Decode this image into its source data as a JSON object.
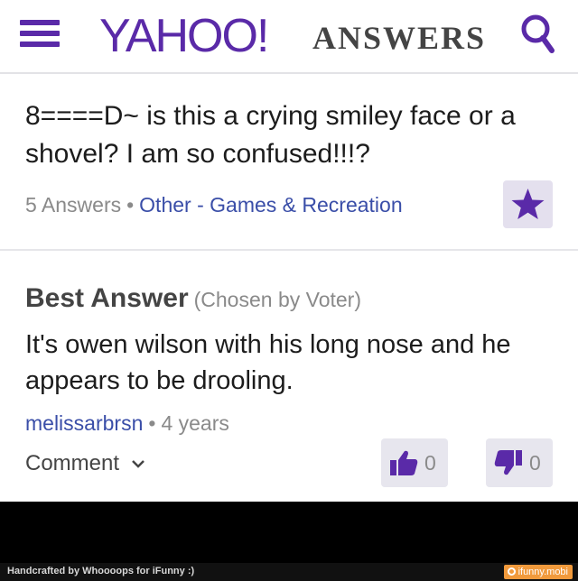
{
  "header": {
    "brand_main": "YAHOO!",
    "brand_sub": "ANSWERS",
    "brand_color": "#5a2aa8"
  },
  "question": {
    "title": "8====D~ is this a crying smiley face or a shovel? I am so confused!!!?",
    "answer_count": "5 Answers",
    "separator": "•",
    "category": "Other - Games & Recreation",
    "save_icon": "star-icon"
  },
  "answer": {
    "heading": "Best Answer",
    "chosen_by": "(Chosen by Voter)",
    "text": "It's owen wilson with his long nose and he appears to be drooling.",
    "author": "melissarbrsn",
    "separator": "•",
    "age": "4 years",
    "comment_label": "Comment",
    "thumbs_up_count": "0",
    "thumbs_down_count": "0"
  },
  "footer": {
    "credit": "Handcrafted by Whoooops for iFunny :)",
    "site": "ifunny.mobi"
  }
}
